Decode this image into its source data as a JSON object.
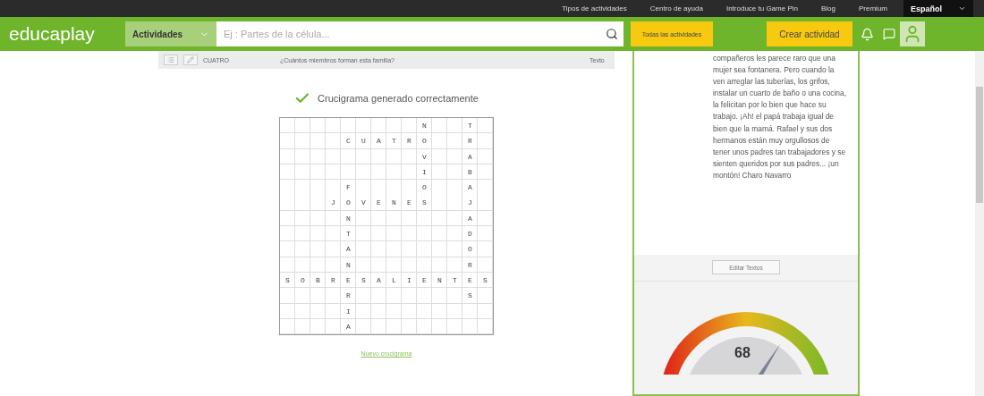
{
  "top_links": [
    "Tipos de actividades",
    "Centro de ayuda",
    "Introduce tu Game Pin",
    "Blog",
    "Premium"
  ],
  "language": "Español",
  "header": {
    "logo_left": "educa",
    "logo_right": "play",
    "category": "Actividades",
    "search_placeholder": "Ej : Partes de la célula...",
    "all_activities": "Todas las actividades",
    "create": "Crear actividad"
  },
  "question_row": {
    "answer": "CUATRO",
    "question": "¿Cuántos miembros forman esta familia?",
    "type": "Texto"
  },
  "success_message": "Crucigrama generado correctamente",
  "crossword": [
    "         N  T ",
    "    CUATRO  R ",
    "         V  A ",
    "         I  B ",
    "    F    O  A ",
    "   JOVENES  J ",
    "    N       A ",
    "    T       D ",
    "    A       O ",
    "    N       R ",
    "SOBRESALIENTES",
    "    R       S ",
    "    I         ",
    "    A         "
  ],
  "new_crossword_link": "Nuevo crucigrama",
  "side_panel": {
    "text": "compañeros les parece raro que una mujer sea fontanera. Pero cuando la ven arreglar las tuberías, los grifos, instalar un cuarto de baño o una cocina, la felicitan por lo bien que hace su trabajo. ¡Ah! el papá trabaja igual de bien que la mamá. Rafael y sus dos hermanos están muy orgullosos de tener unos padres tan trabajadores y se sienten queridos por sus padres... ¡un montón! Charo Navarro",
    "edit_button": "Editar Textos",
    "gauge": {
      "reading": "68",
      "level": 0.68
    }
  }
}
